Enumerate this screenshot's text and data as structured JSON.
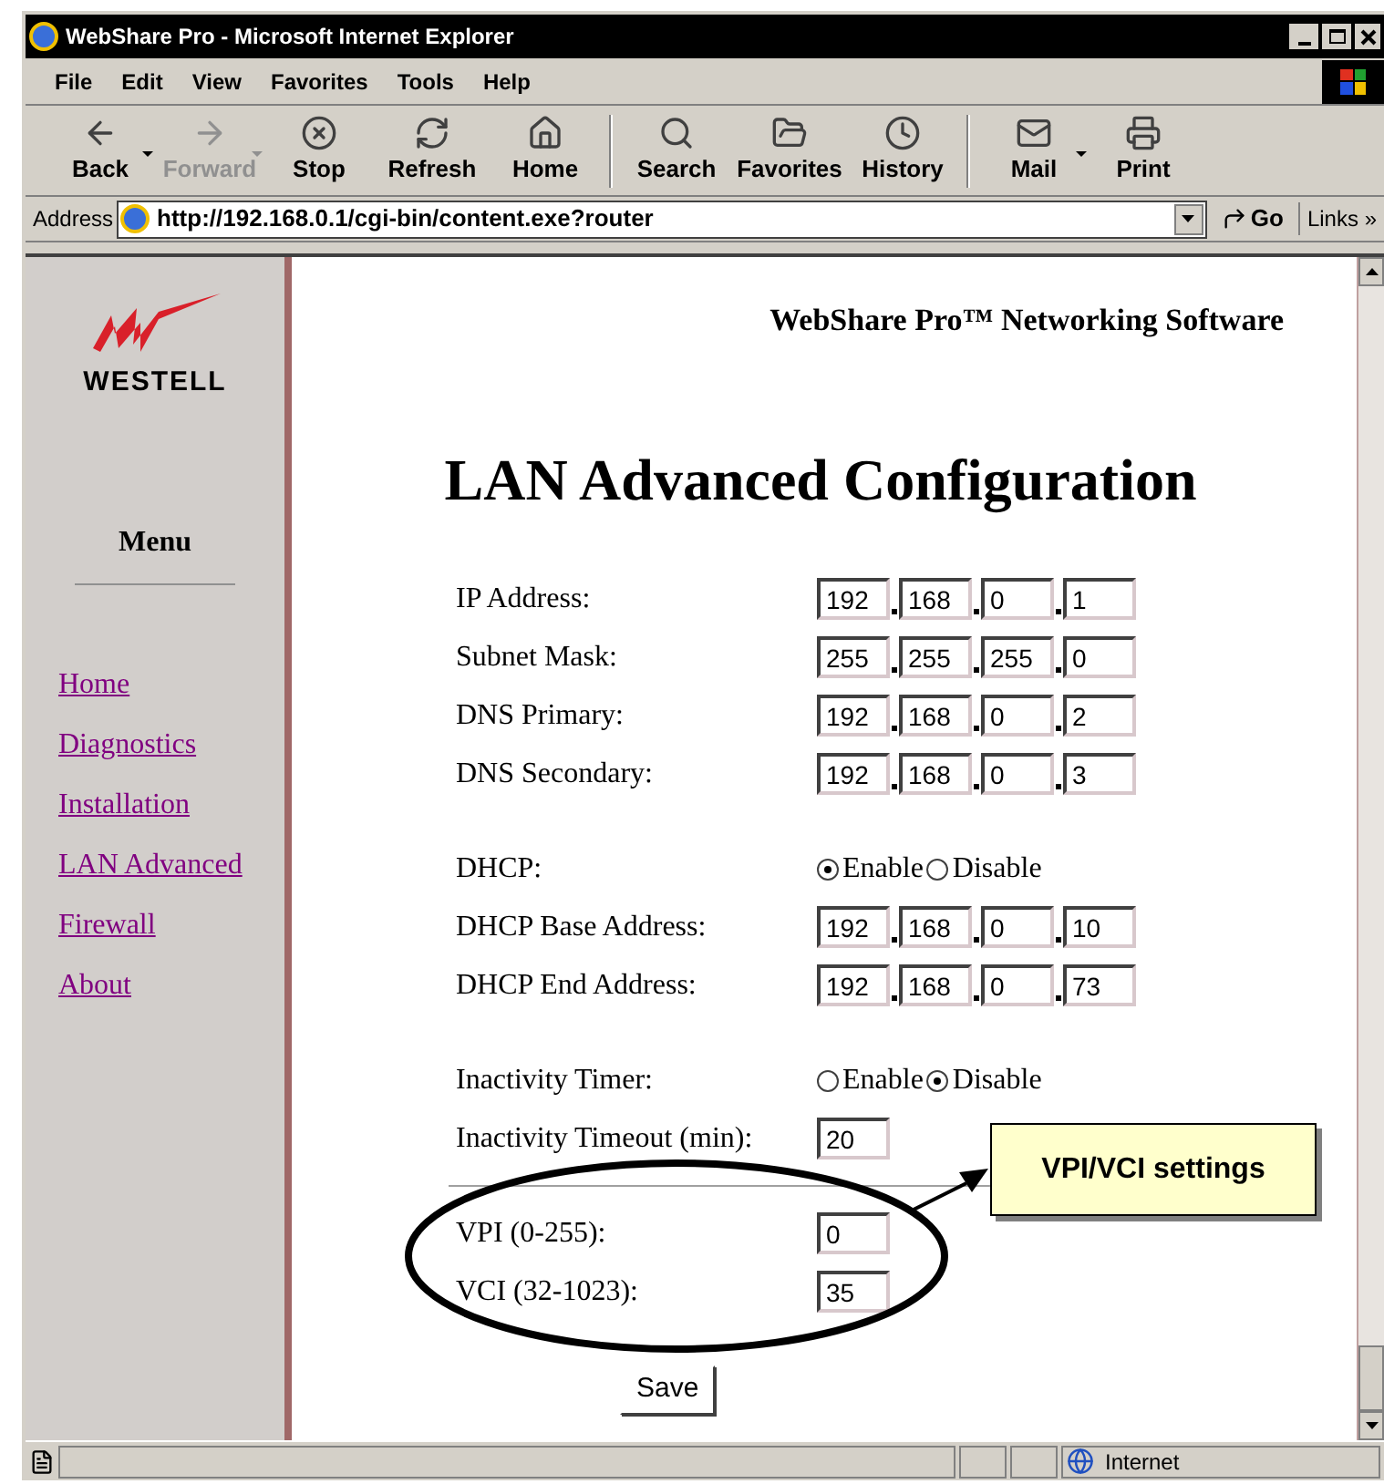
{
  "window": {
    "title": "WebShare Pro - Microsoft Internet Explorer"
  },
  "menu": [
    "File",
    "Edit",
    "View",
    "Favorites",
    "Tools",
    "Help"
  ],
  "toolbar": [
    {
      "label": "Back",
      "kind": "back",
      "disabled": false,
      "dropdown": true
    },
    {
      "label": "Forward",
      "kind": "forward",
      "disabled": true,
      "dropdown": true
    },
    {
      "label": "Stop",
      "kind": "stop",
      "disabled": false,
      "dropdown": false
    },
    {
      "label": "Refresh",
      "kind": "refresh",
      "disabled": false,
      "dropdown": false
    },
    {
      "label": "Home",
      "kind": "home",
      "disabled": false,
      "dropdown": false
    },
    {
      "label": "Search",
      "kind": "search",
      "disabled": false,
      "dropdown": false,
      "separator_before": true
    },
    {
      "label": "Favorites",
      "kind": "favorites",
      "disabled": false,
      "dropdown": false
    },
    {
      "label": "History",
      "kind": "history",
      "disabled": false,
      "dropdown": false
    },
    {
      "label": "Mail",
      "kind": "mail",
      "disabled": false,
      "dropdown": true,
      "separator_before": true
    },
    {
      "label": "Print",
      "kind": "print",
      "disabled": false,
      "dropdown": false
    }
  ],
  "address_bar": {
    "label": "Address",
    "url": "http://192.168.0.1/cgi-bin/content.exe?router",
    "go": "Go",
    "links": "Links",
    "more": "»"
  },
  "sidebar": {
    "brand": "WESTELL",
    "menu_title": "Menu",
    "links": [
      "Home",
      "Diagnostics",
      "Installation",
      "LAN Advanced",
      "Firewall",
      "About"
    ]
  },
  "page": {
    "header": "WebShare Pro™ Networking Software",
    "heading": "LAN Advanced Configuration",
    "groups": [
      [
        {
          "label": "IP Address:",
          "kind": "ip",
          "octets": [
            "192",
            "168",
            "0",
            "1"
          ]
        },
        {
          "label": "Subnet Mask:",
          "kind": "ip",
          "octets": [
            "255",
            "255",
            "255",
            "0"
          ]
        },
        {
          "label": "DNS Primary:",
          "kind": "ip",
          "octets": [
            "192",
            "168",
            "0",
            "2"
          ]
        },
        {
          "label": "DNS Secondary:",
          "kind": "ip",
          "octets": [
            "192",
            "168",
            "0",
            "3"
          ]
        }
      ],
      [
        {
          "label": "DHCP:",
          "kind": "radio",
          "options": [
            {
              "label": "Enable",
              "selected": true
            },
            {
              "label": "Disable",
              "selected": false
            }
          ]
        },
        {
          "label": "DHCP Base Address:",
          "kind": "ip",
          "octets": [
            "192",
            "168",
            "0",
            "10"
          ]
        },
        {
          "label": "DHCP End Address:",
          "kind": "ip",
          "octets": [
            "192",
            "168",
            "0",
            "73"
          ]
        }
      ],
      [
        {
          "label": "Inactivity Timer:",
          "kind": "radio",
          "options": [
            {
              "label": "Enable",
              "selected": false
            },
            {
              "label": "Disable",
              "selected": true
            }
          ]
        },
        {
          "label": "Inactivity Timeout (min):",
          "kind": "text",
          "value": "20"
        }
      ],
      [
        {
          "label": "VPI (0-255):",
          "kind": "text",
          "value": "0"
        },
        {
          "label": "VCI (32-1023):",
          "kind": "text",
          "value": "35"
        }
      ]
    ],
    "save": "Save"
  },
  "callout": {
    "text": "VPI/VCI settings"
  },
  "status_bar": {
    "zone": "Internet"
  }
}
